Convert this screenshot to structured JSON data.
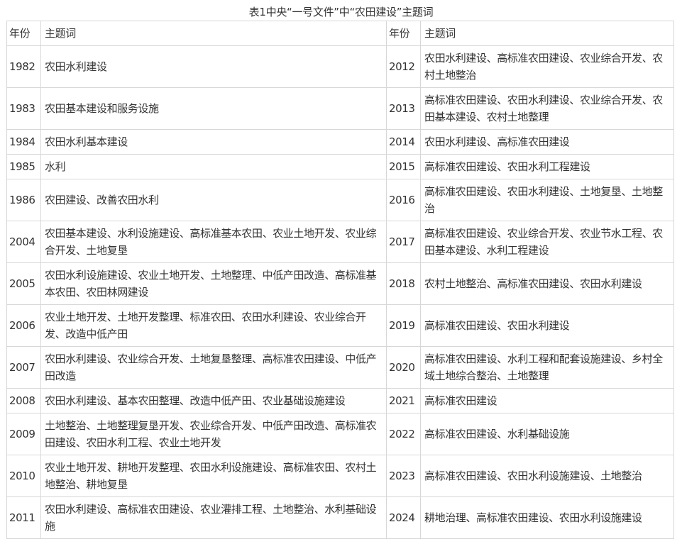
{
  "caption": "表1中央“一号文件”中“农田建设”主题词",
  "headers": [
    "年份",
    "主题词",
    "年份",
    "主题词"
  ],
  "rows": [
    {
      "year1": "1982",
      "topic1": "农田水利建设",
      "year2": "2012",
      "topic2": "农田水利建设、高标准农田建设、农业综合开发、农村土地整治"
    },
    {
      "year1": "1983",
      "topic1": "农田基本建设和服务设施",
      "year2": "2013",
      "topic2": "高标准农田建设、农田水利建设、农业综合开发、农田基本建设、农村土地整理"
    },
    {
      "year1": "1984",
      "topic1": "农田水利基本建设",
      "year2": "2014",
      "topic2": "农田水利建设、高标准农田建设"
    },
    {
      "year1": "1985",
      "topic1": "水利",
      "year2": "2015",
      "topic2": "高标准农田建设、农田水利工程建设"
    },
    {
      "year1": "1986",
      "topic1": "农田建设、改善农田水利",
      "year2": "2016",
      "topic2": "高标准农田建设、农田水利建设、土地复垦、土地整治"
    },
    {
      "year1": "2004",
      "topic1": "农田基本建设、水利设施建设、高标准基本农田、农业土地开发、农业综合开发、土地复垦",
      "year2": "2017",
      "topic2": "高标准农田建设、农业综合开发、农业节水工程、农田基本建设、水利工程建设"
    },
    {
      "year1": "2005",
      "topic1": "农田水利设施建设、农业土地开发、土地整理、中低产田改造、高标准基本农田、农田林网建设",
      "year2": "2018",
      "topic2": "农村土地整治、高标准农田建设、农田水利建设"
    },
    {
      "year1": "2006",
      "topic1": "农业土地开发、土地开发整理、标准农田、农田水利建设、农业综合开发、改造中低产田",
      "year2": "2019",
      "topic2": "高标准农田建设、农田水利建设"
    },
    {
      "year1": "2007",
      "topic1": "农田水利建设、农业综合开发、土地复垦整理、高标准农田建设、中低产田改造",
      "year2": "2020",
      "topic2": "高标准农田建设、水利工程和配套设施建设、乡村全域土地综合整治、土地整理"
    },
    {
      "year1": "2008",
      "topic1": "农田水利建设、基本农田整理、改造中低产田、农业基础设施建设",
      "year2": "2021",
      "topic2": "高标准农田建设"
    },
    {
      "year1": "2009",
      "topic1": "土地整治、土地整理复垦开发、农业综合开发、中低产田改造、高标准农田建设、农田水利工程、农业土地开发",
      "year2": "2022",
      "topic2": "高标准农田建设、水利基础设施"
    },
    {
      "year1": "2010",
      "topic1": "农业土地开发、耕地开发整理、农田水利设施建设、高标准农田、农村土地整治、耕地复垦",
      "year2": "2023",
      "topic2": "高标准农田建设、农田水利设施建设、土地整治"
    },
    {
      "year1": "2011",
      "topic1": "农田水利建设、高标准农田建设、农业灌排工程、土地整治、水利基础设施",
      "year2": "2024",
      "topic2": "耕地治理、高标准农田建设、农田水利设施建设"
    }
  ]
}
